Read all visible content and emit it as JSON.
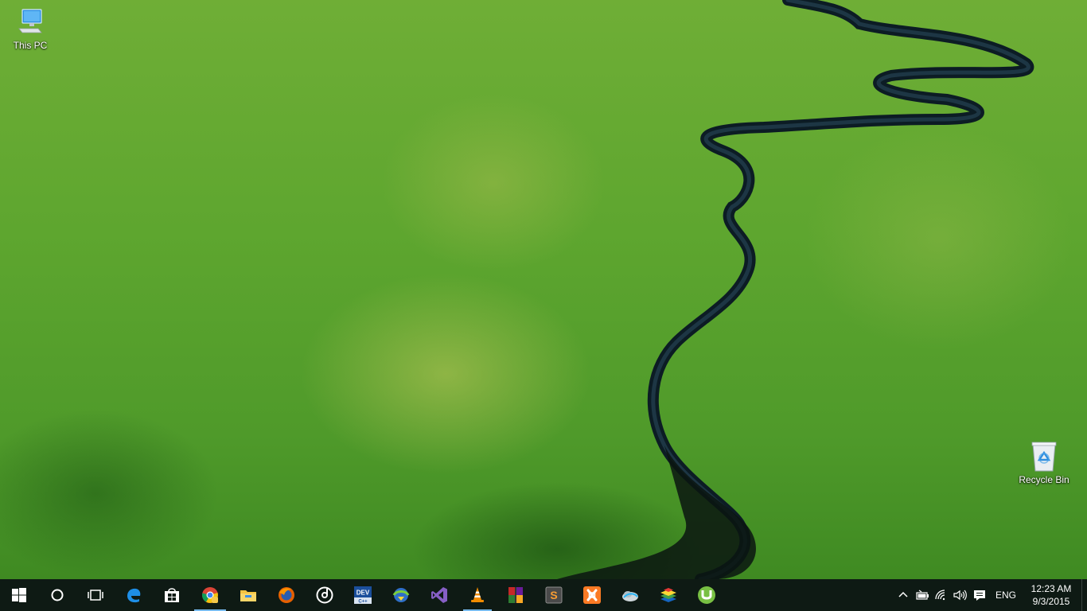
{
  "desktop": {
    "icons": [
      {
        "name": "this-pc",
        "label": "This PC",
        "icon": "computer-icon"
      },
      {
        "name": "recycle-bin",
        "label": "Recycle Bin",
        "icon": "recycle-bin-icon"
      }
    ]
  },
  "taskbar": {
    "start": {
      "icon": "windows-logo-icon"
    },
    "search": {
      "icon": "cortana-circle-icon"
    },
    "task_view": {
      "icon": "task-view-icon"
    },
    "pinned_apps": [
      {
        "name": "edge",
        "icon": "edge-icon"
      },
      {
        "name": "store",
        "icon": "store-icon"
      },
      {
        "name": "chrome",
        "icon": "chrome-icon",
        "state": "active"
      },
      {
        "name": "file-explorer",
        "icon": "folder-icon"
      },
      {
        "name": "firefox",
        "icon": "firefox-icon"
      },
      {
        "name": "groove-music",
        "icon": "groove-icon"
      },
      {
        "name": "dev-cpp",
        "icon": "devcpp-icon",
        "text": "DEV C++"
      },
      {
        "name": "internet-download-manager",
        "icon": "idm-icon"
      },
      {
        "name": "visual-studio",
        "icon": "visual-studio-icon"
      },
      {
        "name": "vlc",
        "icon": "vlc-cone-icon",
        "state": "running"
      },
      {
        "name": "winrar",
        "icon": "winrar-icon"
      },
      {
        "name": "sublime-text",
        "icon": "sublime-icon",
        "text": "S"
      },
      {
        "name": "xampp",
        "icon": "xampp-icon"
      },
      {
        "name": "bluestacks-cloud",
        "icon": "cloud-app-icon"
      },
      {
        "name": "bluestacks",
        "icon": "bluestacks-icon"
      },
      {
        "name": "utorrent",
        "icon": "utorrent-icon"
      }
    ],
    "tray": {
      "icons": [
        "chevron-up-icon",
        "battery-icon",
        "wifi-icon",
        "volume-icon",
        "action-center-icon"
      ],
      "language": "ENG",
      "time": "12:23 AM",
      "date": "9/3/2015"
    }
  },
  "colors": {
    "taskbar_bg": "#0e1a14",
    "accent": "#76b9ed",
    "river": "#0c1c24"
  }
}
